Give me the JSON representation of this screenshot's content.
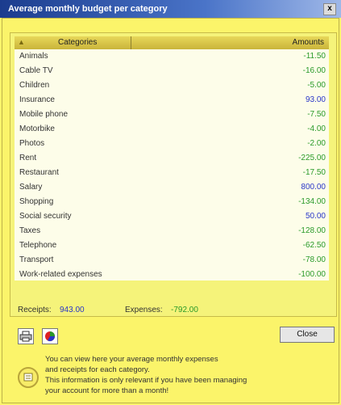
{
  "window": {
    "title": "Average monthly budget per category",
    "close_glyph": "x"
  },
  "table": {
    "header": {
      "category": "Categories",
      "amount": "Amounts",
      "sort_icon": "sort-asc-icon"
    },
    "rows": [
      {
        "category": "Animals",
        "amount": "-11.50",
        "sign": "neg"
      },
      {
        "category": "Cable TV",
        "amount": "-16.00",
        "sign": "neg"
      },
      {
        "category": "Children",
        "amount": "-5.00",
        "sign": "neg"
      },
      {
        "category": "Insurance",
        "amount": "93.00",
        "sign": "pos"
      },
      {
        "category": "Mobile phone",
        "amount": "-7.50",
        "sign": "neg"
      },
      {
        "category": "Motorbike",
        "amount": "-4.00",
        "sign": "neg"
      },
      {
        "category": "Photos",
        "amount": "-2.00",
        "sign": "neg"
      },
      {
        "category": "Rent",
        "amount": "-225.00",
        "sign": "neg"
      },
      {
        "category": "Restaurant",
        "amount": "-17.50",
        "sign": "neg"
      },
      {
        "category": "Salary",
        "amount": "800.00",
        "sign": "pos"
      },
      {
        "category": "Shopping",
        "amount": "-134.00",
        "sign": "neg"
      },
      {
        "category": "Social security",
        "amount": "50.00",
        "sign": "pos"
      },
      {
        "category": "Taxes",
        "amount": "-128.00",
        "sign": "neg"
      },
      {
        "category": "Telephone",
        "amount": "-62.50",
        "sign": "neg"
      },
      {
        "category": "Transport",
        "amount": "-78.00",
        "sign": "neg"
      },
      {
        "category": "Work-related expenses",
        "amount": "-100.00",
        "sign": "neg"
      }
    ]
  },
  "totals": {
    "receipts_label": "Receipts:",
    "receipts_value": "943.00",
    "expenses_label": "Expenses:",
    "expenses_value": "-792.00"
  },
  "toolbar": {
    "print_icon": "print-icon",
    "chart_icon": "pie-chart-icon",
    "close_label": "Close"
  },
  "info": {
    "icon": "info-icon",
    "lines": [
      "You can view here your average monthly expenses",
      "and receipts for each category.",
      "This information is only relevant if you have been managing",
      "your account for more than a month!"
    ]
  },
  "colors": {
    "background": "#fbf46a",
    "titlebar": "#1b3c8e",
    "negative": "#2a9a2a",
    "positive": "#2a36c8"
  }
}
